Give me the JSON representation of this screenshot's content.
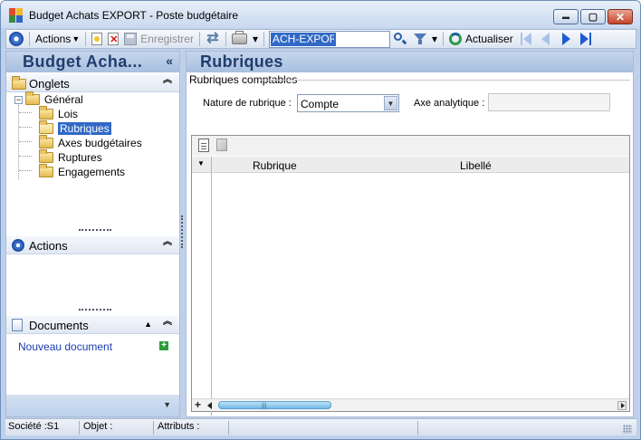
{
  "window": {
    "title": "Budget Achats EXPORT -  Poste budgétaire",
    "minimize_glyph": "▬",
    "maximize_glyph": "▢",
    "close_glyph": "✕"
  },
  "toolbar": {
    "actions_label": "Actions",
    "save_label": "Enregistrer",
    "search_value": "ACH-EXPORT",
    "refresh_label": "Actualiser",
    "dropdown_glyph": "▾"
  },
  "left_panel": {
    "title": "Budget Acha...",
    "collapse_glyph": "«",
    "sections": {
      "tabs_label": "Onglets",
      "actions_label": "Actions",
      "documents_label": "Documents"
    },
    "toggle_glyph": "⌃",
    "tree": {
      "root": "Général",
      "root_expander": "−",
      "items": [
        "Lois",
        "Rubriques",
        "Axes budgétaires",
        "Ruptures",
        "Engagements"
      ]
    },
    "new_document": "Nouveau document",
    "add_glyph": "+",
    "bottom_chevron": "▼"
  },
  "main": {
    "title": "Rubriques",
    "group_label": "Rubriques comptables",
    "nature_label": "Nature de rubrique :",
    "nature_value": "Compte",
    "combo_arrow": "▼",
    "analytic_label": "Axe analytique :",
    "analytic_value": "",
    "grid": {
      "row_indicator": "▼",
      "columns": [
        "Rubrique",
        "Libellé"
      ],
      "add_glyph": "+",
      "scroll_grip": "|||"
    }
  },
  "status": {
    "company": "Société :S1",
    "object": "Objet :",
    "attributes": "Attributs :"
  }
}
